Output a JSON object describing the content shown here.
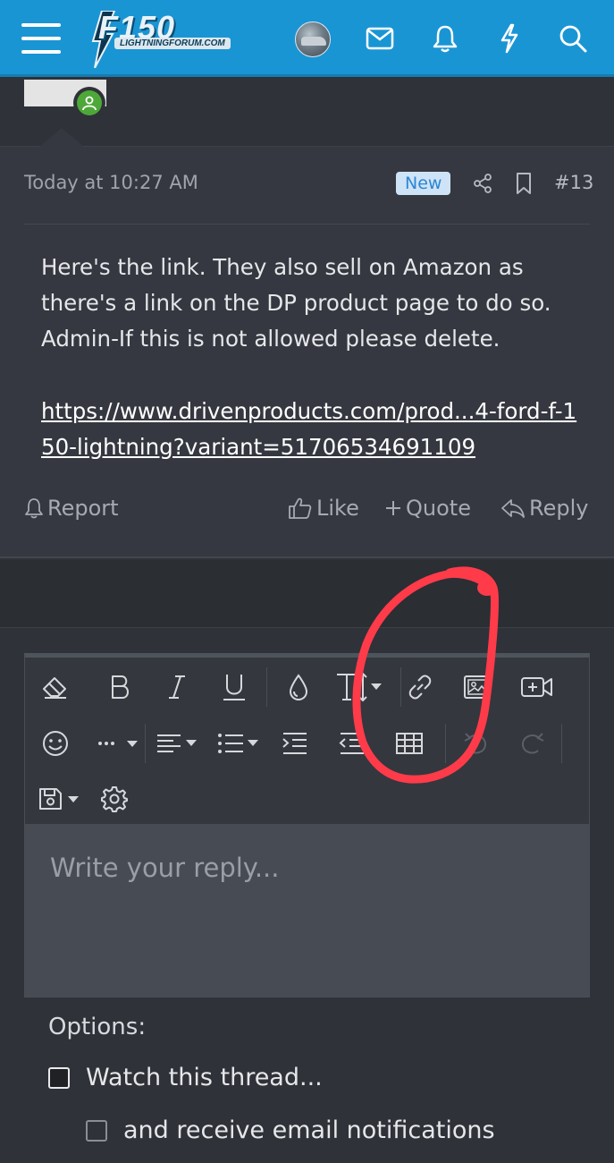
{
  "header": {
    "logo_main": "F150",
    "logo_sub": "LIGHTNINGFORUM.COM",
    "icons": [
      "menu-icon",
      "user-avatar",
      "mail-icon",
      "bell-icon",
      "bolt-icon",
      "search-icon"
    ],
    "brand_color": "#1a95d4"
  },
  "post": {
    "timestamp": "Today at 10:27 AM",
    "badge": "New",
    "number": "#13",
    "body_lines": [
      "Here's the link. They also sell on Amazon as",
      "there's a link on the DP product page to do so.",
      "Admin-If this is not allowed please delete."
    ],
    "link_text": "https://www.drivenproducts.com/prod...4-ford-f-150-lightning?variant=51706534691109",
    "actions": {
      "report": "Report",
      "like": "Like",
      "quote": "Quote",
      "reply": "Reply"
    }
  },
  "editor": {
    "toolbar_row1": [
      "eraser-icon",
      "bold-icon",
      "italic-icon",
      "underline-icon",
      "text-color-icon",
      "font-size-icon",
      "link-icon",
      "image-icon",
      "video-icon"
    ],
    "toolbar_row2": [
      "smilie-icon",
      "more-icon",
      "align-icon",
      "list-icon",
      "indent-icon",
      "outdent-icon",
      "table-icon",
      "undo-icon",
      "redo-icon"
    ],
    "toolbar_row3": [
      "drafts-icon",
      "settings-icon"
    ],
    "placeholder": "Write your reply..."
  },
  "options": {
    "label": "Options:",
    "watch_thread": "Watch this thread...",
    "email_notifications": "and receive email notifications"
  },
  "annotation_color": "#ff3b4a"
}
